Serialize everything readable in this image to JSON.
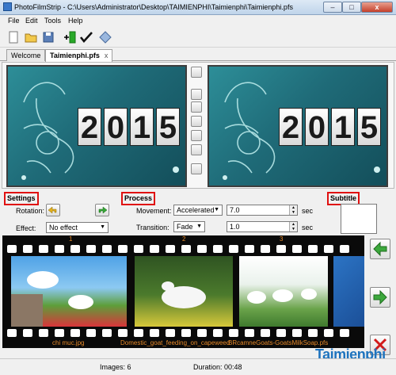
{
  "window": {
    "title": "PhotoFilmStrip - C:\\Users\\Administrator\\Desktop\\TAIMIENPHI\\Taimienphi\\Taimienphi.pfs",
    "close_glyph": "x"
  },
  "menu": [
    "File",
    "Edit",
    "Tools",
    "Help"
  ],
  "tabs": [
    {
      "label": "Welcome"
    },
    {
      "label": "Taimienphi.pfs",
      "close": "x"
    }
  ],
  "preview": {
    "year_digits": [
      "2",
      "0",
      "1",
      "5"
    ]
  },
  "settings": {
    "group_label": "Settings",
    "rotation_label": "Rotation:",
    "effect_label": "Effect:",
    "effect_value": "No effect"
  },
  "process": {
    "group_label": "Process",
    "movement_label": "Movement:",
    "movement_value": "Accelerated",
    "movement_duration": "7.0",
    "transition_label": "Transition:",
    "transition_value": "Fade",
    "transition_duration": "1.0",
    "unit": "sec"
  },
  "subtitle": {
    "group_label": "Subtitle"
  },
  "filmstrip": {
    "frames": [
      {
        "number": "1",
        "filename": "chi muc.jpg"
      },
      {
        "number": "2",
        "filename": "Domestic_goat_feeding_on_capeweed"
      },
      {
        "number": "3",
        "filename": "BRcamneGoats-GoatsMilkSoap.pfs"
      }
    ]
  },
  "status": {
    "images": "Images: 6",
    "duration": "Duration: 00:48"
  },
  "watermark": "Taimienphi",
  "colors": {
    "accent_red": "#e01010",
    "filmstrip_label": "#e88a2a"
  }
}
